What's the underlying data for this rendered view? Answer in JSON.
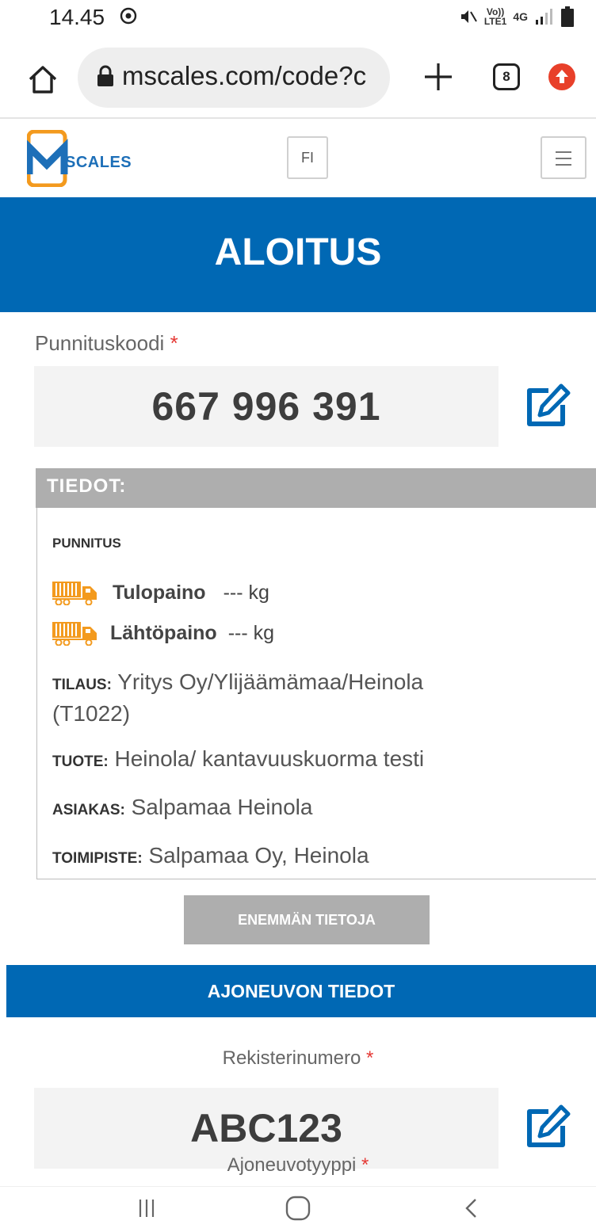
{
  "status_bar": {
    "time": "14.45",
    "network_top": "Vo))",
    "network_bottom": "LTE1",
    "network_type": "4G",
    "icons": [
      "sync-icon",
      "mute-icon",
      "signal-icon",
      "battery-icon"
    ]
  },
  "browser": {
    "url": "mscales.com/code?c",
    "tab_count": "8",
    "icons": [
      "home-icon",
      "lock-icon",
      "plus-icon",
      "tabs-icon",
      "update-icon"
    ]
  },
  "header": {
    "logo_text": "SCALES",
    "language": "FI",
    "icons": [
      "mscales-logo",
      "hamburger-menu-icon"
    ]
  },
  "hero": {
    "title": "ALOITUS"
  },
  "weighing": {
    "label": "Punnituskoodi",
    "required": "*",
    "code": "667 996 391"
  },
  "details": {
    "header": "TIEDOT:",
    "section_title": "PUNNITUS",
    "arrival_label": "Tulopaino",
    "arrival_value": "--- kg",
    "departure_label": "Lähtöpaino",
    "departure_value": "--- kg",
    "order_key": "TILAUS:",
    "order_value": " Yritys Oy/Ylijäämämaa/Heinola",
    "order_code": "(T1022)",
    "product_key": "TUOTE:",
    "product_value": " Heinola/ kantavuuskuorma testi",
    "customer_key": "ASIAKAS:",
    "customer_value": " Salpamaa Heinola",
    "office_key": "TOIMIPISTE:",
    "office_value": " Salpamaa Oy, Heinola",
    "more_button": "ENEMMÄN TIETOJA"
  },
  "vehicle": {
    "header": "AJONEUVON TIEDOT",
    "plate_label": "Rekisterinumero",
    "plate_value": "ABC123",
    "type_label": "Ajoneuvotyyppi",
    "required": "*"
  },
  "colors": {
    "brand_blue": "#0068b4",
    "logo_orange": "#f39a1e",
    "required_red": "#e53935",
    "panel_grey": "#aeaeae"
  }
}
